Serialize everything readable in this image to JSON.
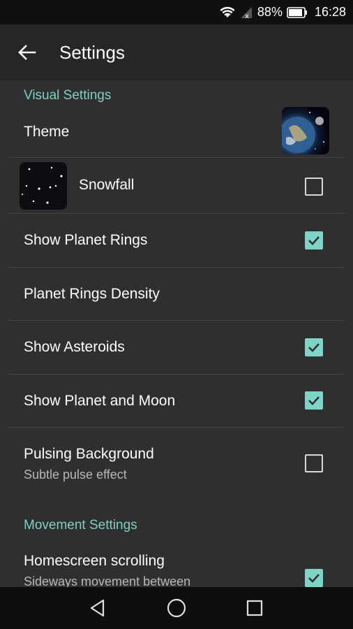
{
  "status_bar": {
    "battery_percent": "88%",
    "time": "16:28",
    "icons": [
      "wifi-icon",
      "signal-icon",
      "battery-icon"
    ]
  },
  "toolbar": {
    "title": "Settings",
    "back_icon": "arrow-back-icon"
  },
  "sections": {
    "visual": {
      "header": "Visual Settings"
    },
    "movement": {
      "header": "Movement Settings"
    }
  },
  "settings": {
    "theme": {
      "label": "Theme"
    },
    "snowfall": {
      "label": "Snowfall",
      "checked": false
    },
    "planet_rings": {
      "label": "Show Planet Rings",
      "checked": true
    },
    "rings_density": {
      "label": "Planet Rings Density"
    },
    "asteroids": {
      "label": "Show Asteroids",
      "checked": true
    },
    "planet_moon": {
      "label": "Show Planet and Moon",
      "checked": true
    },
    "pulsing": {
      "label": "Pulsing Background",
      "sublabel": "Subtle pulse effect",
      "checked": false
    },
    "homescreen_scrolling": {
      "label": "Homescreen scrolling",
      "sublabel": "Sideways movement between",
      "checked": true
    }
  },
  "colors": {
    "accent": "#7fcfc4",
    "checkbox_checked": "#7fd4c8",
    "background": "#2f2f2f",
    "toolbar": "#262626"
  },
  "nav_bar": {
    "icons": [
      "back-triangle-icon",
      "home-circle-icon",
      "recents-square-icon"
    ]
  }
}
